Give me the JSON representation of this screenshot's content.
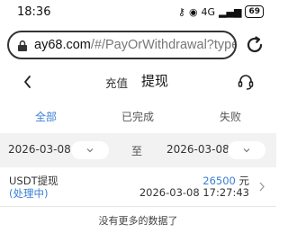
{
  "status_bar": {
    "time": "18:36",
    "network": "4G",
    "battery": "69"
  },
  "browser": {
    "url_domain": "ay68.com",
    "url_path": "/#/PayOrWithdrawal?type",
    "icons": [
      "lock-icon",
      "reload-icon"
    ]
  },
  "header": {
    "tab_deposit": "充值",
    "tab_withdraw": "提现",
    "icons": [
      "back-icon",
      "support-icon"
    ]
  },
  "filter_tabs": [
    {
      "label": "全部",
      "active": true
    },
    {
      "label": "已完成",
      "active": false
    },
    {
      "label": "失败",
      "active": false
    }
  ],
  "date_filter": {
    "start": "2026-03-08",
    "separator": "至",
    "end": "2026-03-08"
  },
  "records": [
    {
      "type": "USDT提现",
      "status": "(处理中)",
      "amount": "26500",
      "unit": "元",
      "time": "2026-03-08 17:27:43"
    }
  ],
  "footer": {
    "no_more": "没有更多的数据了"
  },
  "colors": {
    "accent": "#3a7fd6",
    "date_bar_bg": "#f2f2f2"
  }
}
